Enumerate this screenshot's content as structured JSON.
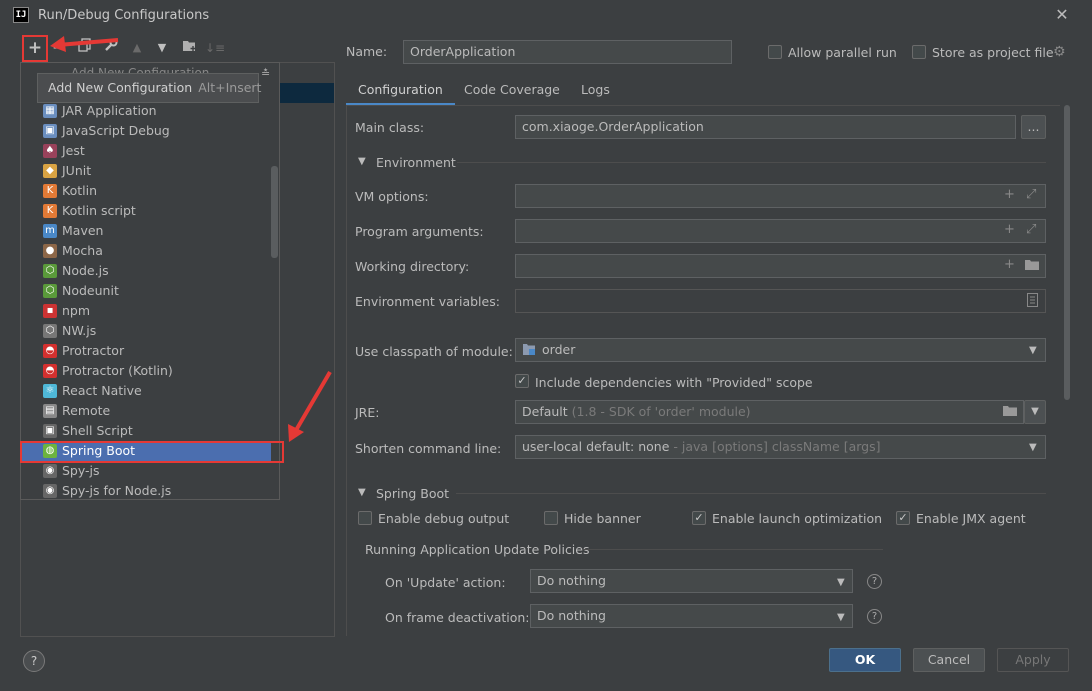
{
  "window": {
    "title": "Run/Debug Configurations",
    "app_icon": "IJ"
  },
  "toolbar": {
    "icons": [
      "add-icon",
      "remove-icon",
      "copy-icon",
      "wrench-icon",
      "move-up-icon",
      "move-down-icon",
      "folder-add-icon",
      "sort-icon"
    ]
  },
  "tooltip": {
    "label": "Add New Configuration",
    "shortcut": "Alt+Insert"
  },
  "dropdown": {
    "peek": "Add New Configuration",
    "items": [
      {
        "label": "JAR Application",
        "icon": "jar-icon",
        "color": "#6a8ebf"
      },
      {
        "label": "JavaScript Debug",
        "icon": "js-debug-icon",
        "color": "#6a8ebf"
      },
      {
        "label": "Jest",
        "icon": "jest-icon",
        "color": "#99425b"
      },
      {
        "label": "JUnit",
        "icon": "junit-icon",
        "color": "#d9a343"
      },
      {
        "label": "Kotlin",
        "icon": "kotlin-icon",
        "color": "#e27a36"
      },
      {
        "label": "Kotlin script",
        "icon": "kotlin-script-icon",
        "color": "#e27a36"
      },
      {
        "label": "Maven",
        "icon": "maven-icon",
        "color": "#4a88c7"
      },
      {
        "label": "Mocha",
        "icon": "mocha-icon",
        "color": "#8d6748"
      },
      {
        "label": "Node.js",
        "icon": "nodejs-icon",
        "color": "#5a9a3a"
      },
      {
        "label": "Nodeunit",
        "icon": "nodeunit-icon",
        "color": "#5a9a3a"
      },
      {
        "label": "npm",
        "icon": "npm-icon",
        "color": "#c33"
      },
      {
        "label": "NW.js",
        "icon": "nwjs-icon",
        "color": "#777"
      },
      {
        "label": "Protractor",
        "icon": "protractor-icon",
        "color": "#d3302f"
      },
      {
        "label": "Protractor (Kotlin)",
        "icon": "protractor-kotlin-icon",
        "color": "#d3302f"
      },
      {
        "label": "React Native",
        "icon": "react-icon",
        "color": "#4fb8d8"
      },
      {
        "label": "Remote",
        "icon": "remote-icon",
        "color": "#888"
      },
      {
        "label": "Shell Script",
        "icon": "shell-icon",
        "color": "#666"
      },
      {
        "label": "Spring Boot",
        "icon": "spring-boot-icon",
        "color": "#6cb33f"
      },
      {
        "label": "Spy-js",
        "icon": "spyjs-icon",
        "color": "#666"
      },
      {
        "label": "Spy-js for Node.js",
        "icon": "spyjs-node-icon",
        "color": "#666"
      }
    ],
    "selected_index": 17
  },
  "form": {
    "name_label": "Name:",
    "name_value": "OrderApplication",
    "allow_parallel_label": "Allow parallel run",
    "store_project_label": "Store as project file",
    "tabs": [
      "Configuration",
      "Code Coverage",
      "Logs"
    ],
    "active_tab": 0,
    "main_class_label": "Main class:",
    "main_class_value": "com.xiaoge.OrderApplication",
    "browse_label": "...",
    "environment_header": "Environment",
    "vm_options_label": "VM options:",
    "program_args_label": "Program arguments:",
    "working_dir_label": "Working directory:",
    "env_vars_label": "Environment variables:",
    "classpath_label": "Use classpath of module:",
    "classpath_value": "order",
    "include_deps_label": "Include dependencies with \"Provided\" scope",
    "jre_label": "JRE:",
    "jre_value": "Default",
    "jre_hint": "(1.8 - SDK of 'order' module)",
    "shorten_label": "Shorten command line:",
    "shorten_value": "user-local default: none",
    "shorten_hint": "- java [options] className [args]",
    "spring_boot_header": "Spring Boot",
    "enable_debug_label": "Enable debug output",
    "hide_banner_label": "Hide banner",
    "launch_opt_label": "Enable launch optimization",
    "jmx_label": "Enable JMX agent",
    "update_policies_header": "Running Application Update Policies",
    "on_update_label": "On 'Update' action:",
    "on_update_value": "Do nothing",
    "on_frame_label": "On frame deactivation:",
    "on_frame_value": "Do nothing",
    "help_glyph": "?"
  },
  "footer": {
    "help": "?",
    "ok": "OK",
    "cancel": "Cancel",
    "apply": "Apply"
  },
  "colors": {
    "highlight": "#e53935",
    "selection": "#4b6eaf",
    "tab_accent": "#4a88c7",
    "ok_button": "#365880"
  }
}
